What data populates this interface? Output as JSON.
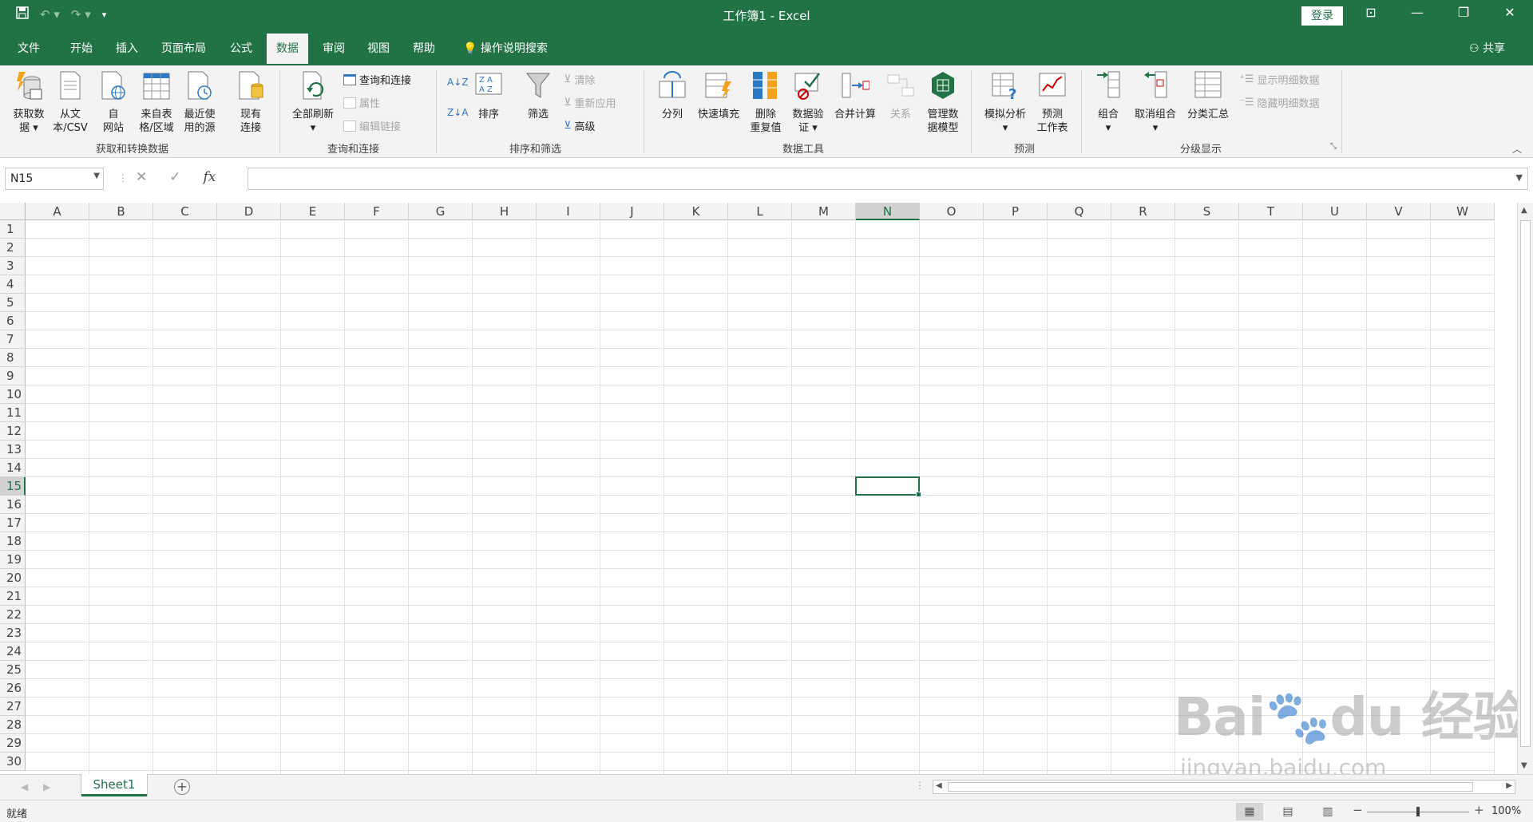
{
  "window": {
    "title": "工作簿1  -  Excel",
    "login_label": "登录",
    "controls": [
      "restore-ribbon-icon",
      "minimize-icon",
      "restore-icon",
      "close-icon"
    ]
  },
  "qat": {
    "save_icon": "save-icon",
    "undo_icon": "undo-icon",
    "redo_icon": "redo-icon",
    "customize_icon": "customize-qat-icon"
  },
  "tabs": [
    {
      "label": "文件"
    },
    {
      "label": "开始"
    },
    {
      "label": "插入"
    },
    {
      "label": "页面布局"
    },
    {
      "label": "公式"
    },
    {
      "label": "数据",
      "active": true
    },
    {
      "label": "审阅"
    },
    {
      "label": "视图"
    },
    {
      "label": "帮助"
    }
  ],
  "tell_me": "操作说明搜索",
  "share": "共享",
  "ribbon": {
    "get_transform": {
      "label": "获取和转换数据",
      "buttons": [
        {
          "line1": "获取数",
          "line2": "据 ▾"
        },
        {
          "line1": "从文",
          "line2": "本/CSV"
        },
        {
          "line1": "自",
          "line2": "网站"
        },
        {
          "line1": "来自表",
          "line2": "格/区域"
        },
        {
          "line1": "最近使",
          "line2": "用的源"
        },
        {
          "line1": "现有",
          "line2": "连接"
        }
      ]
    },
    "queries": {
      "label": "查询和连接",
      "refresh": {
        "line1": "全部刷新",
        "line2": "▾"
      },
      "small": [
        {
          "label": "查询和连接",
          "disabled": false
        },
        {
          "label": "属性",
          "disabled": true
        },
        {
          "label": "编辑链接",
          "disabled": true
        }
      ]
    },
    "sort_filter": {
      "label": "排序和筛选",
      "sort_label": "排序",
      "filter_label": "筛选",
      "small": [
        {
          "label": "清除",
          "disabled": true
        },
        {
          "label": "重新应用",
          "disabled": true
        },
        {
          "label": "高级",
          "disabled": false
        }
      ]
    },
    "data_tools": {
      "label": "数据工具",
      "buttons": [
        {
          "line1": "分列",
          "line2": ""
        },
        {
          "line1": "快速填充",
          "line2": ""
        },
        {
          "line1": "删除",
          "line2": "重复值"
        },
        {
          "line1": "数据验",
          "line2": "证 ▾"
        },
        {
          "line1": "合并计算",
          "line2": ""
        },
        {
          "line1": "关系",
          "line2": "",
          "disabled": true
        },
        {
          "line1": "管理数",
          "line2": "据模型"
        }
      ]
    },
    "forecast": {
      "label": "预测",
      "buttons": [
        {
          "line1": "模拟分析",
          "line2": "▾"
        },
        {
          "line1": "预测",
          "line2": "工作表"
        }
      ]
    },
    "outline": {
      "label": "分级显示",
      "buttons": [
        {
          "line1": "组合",
          "line2": "▾"
        },
        {
          "line1": "取消组合",
          "line2": "▾"
        },
        {
          "line1": "分类汇总",
          "line2": ""
        }
      ],
      "small": [
        {
          "label": "显示明细数据",
          "disabled": true
        },
        {
          "label": "隐藏明细数据",
          "disabled": true
        }
      ]
    }
  },
  "formula_bar": {
    "name_box": "N15",
    "fx": "fx",
    "cancel": "✕",
    "enter": "✓",
    "value": ""
  },
  "grid": {
    "columns": [
      "A",
      "B",
      "C",
      "D",
      "E",
      "F",
      "G",
      "H",
      "I",
      "J",
      "K",
      "L",
      "M",
      "N",
      "O",
      "P",
      "Q",
      "R",
      "S",
      "T",
      "U",
      "V",
      "W"
    ],
    "rows": [
      "1",
      "2",
      "3",
      "4",
      "5",
      "6",
      "7",
      "8",
      "9",
      "10",
      "11",
      "12",
      "13",
      "14",
      "15",
      "16",
      "17",
      "18",
      "19",
      "20",
      "21",
      "22",
      "23",
      "24",
      "25",
      "26",
      "27",
      "28",
      "29",
      "30"
    ],
    "active_cell": "N15"
  },
  "sheets": [
    {
      "label": "Sheet1",
      "active": true
    }
  ],
  "add_sheet": "+",
  "status": {
    "text": "就绪",
    "zoom": "100%"
  },
  "watermark": {
    "logo": "Baidu经验",
    "url": "jingyan.baidu.com"
  }
}
